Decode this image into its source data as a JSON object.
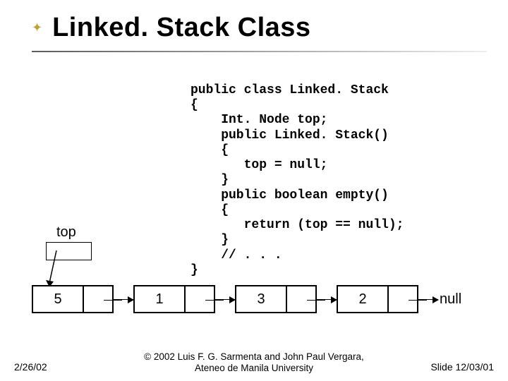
{
  "title": "Linked. Stack Class",
  "code_lines": [
    "public class Linked. Stack",
    "{",
    "    Int. Node top;",
    "    public Linked. Stack()",
    "    {",
    "       top = null;",
    "    }",
    "    public boolean empty()",
    "    {",
    "       return (top == null);",
    "    }",
    "    // . . .",
    "}"
  ],
  "top_label": "top",
  "nodes": [
    "5",
    "1",
    "3",
    "2"
  ],
  "null_label": "null",
  "footer": {
    "left": "2/26/02",
    "center_line1": "© 2002 Luis F. G. Sarmenta and John Paul Vergara,",
    "center_line2": "Ateneo de Manila University",
    "right": "Slide 12/03/01"
  }
}
